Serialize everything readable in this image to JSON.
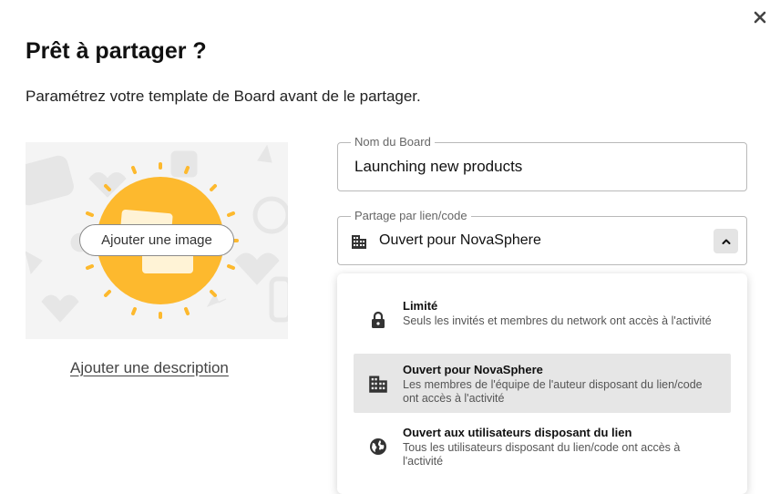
{
  "modal": {
    "title": "Prêt à partager ?",
    "subtitle": "Paramétrez votre template de Board avant de le partager."
  },
  "image_panel": {
    "button_label": "Ajouter une image"
  },
  "description_link": "Ajouter une description",
  "name_field": {
    "legend": "Nom du Board",
    "value": "Launching new products"
  },
  "share_field": {
    "legend": "Partage par lien/code",
    "value": "Ouvert pour NovaSphere",
    "icon": "building-icon"
  },
  "share_options": [
    {
      "icon": "lock-icon",
      "title": "Limité",
      "description": "Seuls les invités et membres du network ont accès à l'activité",
      "selected": false
    },
    {
      "icon": "building-icon",
      "title": "Ouvert pour NovaSphere",
      "description": "Les membres de l'équipe de l'auteur disposant du lien/code ont accès à l'activité",
      "selected": true
    },
    {
      "icon": "globe-icon",
      "title": "Ouvert aux utilisateurs disposant du lien",
      "description": "Tous les utilisateurs disposant du lien/code ont accès à l'activité",
      "selected": false
    }
  ],
  "colors": {
    "accent_yellow": "#FDB92E",
    "selected_option_bg": "#E6E6E6",
    "illustration_bg": "#F4F4F4"
  }
}
